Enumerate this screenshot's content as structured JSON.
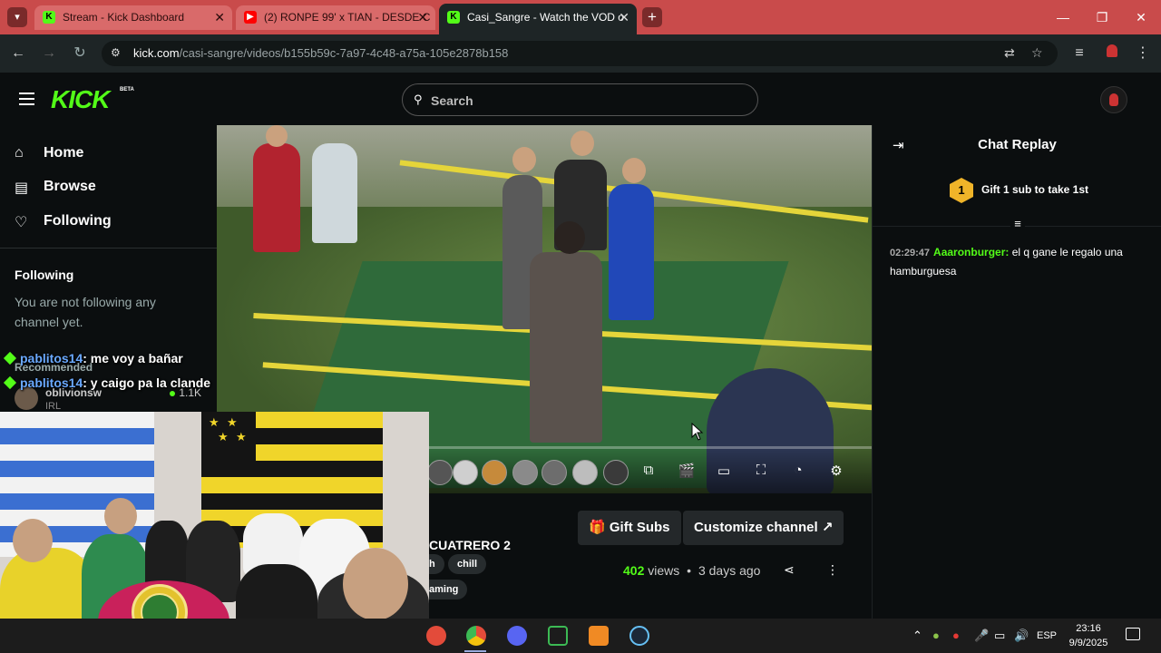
{
  "browser": {
    "tabs": [
      {
        "title": "Stream - Kick Dashboard",
        "favicon": "K"
      },
      {
        "title": "(2) RONPE 99' x TIAN - DESDE C",
        "favicon": "▶"
      },
      {
        "title": "Casi_Sangre - Watch the VOD o",
        "favicon": "K"
      }
    ],
    "url_host": "kick.com",
    "url_path": "/casi-sangre/videos/b155b59c-7a97-4c48-a75a-105e2878b158"
  },
  "header": {
    "logo": "KICK",
    "beta": "BETA",
    "search_placeholder": "Search"
  },
  "sidebar": {
    "items": [
      {
        "label": "Home",
        "icon": "home-icon"
      },
      {
        "label": "Browse",
        "icon": "browse-icon"
      },
      {
        "label": "Following",
        "icon": "heart-icon"
      }
    ],
    "following_heading": "Following",
    "following_empty": "You are not following any channel yet.",
    "recommended_heading": "Recommended",
    "recommended": [
      {
        "name": "oblivionsw",
        "category": "IRL",
        "viewers": "1.1K"
      }
    ]
  },
  "overlay_chat": [
    {
      "user": "pablitos14",
      "text": ": me voy a bañar"
    },
    {
      "user": "pablitos14",
      "text": ": y caigo pa la clande"
    }
  ],
  "video": {
    "progress": 0.26
  },
  "below": {
    "title_fragment": "CUATRERO 2",
    "tags": [
      "h",
      "chill",
      "aming"
    ],
    "gift_subs": "Gift Subs",
    "customize": "Customize channel",
    "views_count": "402",
    "views_label": "views",
    "dot": "•",
    "age": "3 days ago"
  },
  "chat": {
    "title": "Chat Replay",
    "gift_rank": "1",
    "gift_text": "Gift 1 sub to take 1st",
    "messages": [
      {
        "time": "02:29:47",
        "user": "Aaaronburger",
        "sep": ":",
        "text": " el q gane le regalo una hamburguesa"
      }
    ]
  },
  "taskbar": {
    "lang": "ESP",
    "time": "23:16",
    "date": "9/9/2025"
  },
  "colors": {
    "kick_green": "#53fc18",
    "tab_strip": "#c94b4b",
    "background": "#0b0e0f"
  }
}
